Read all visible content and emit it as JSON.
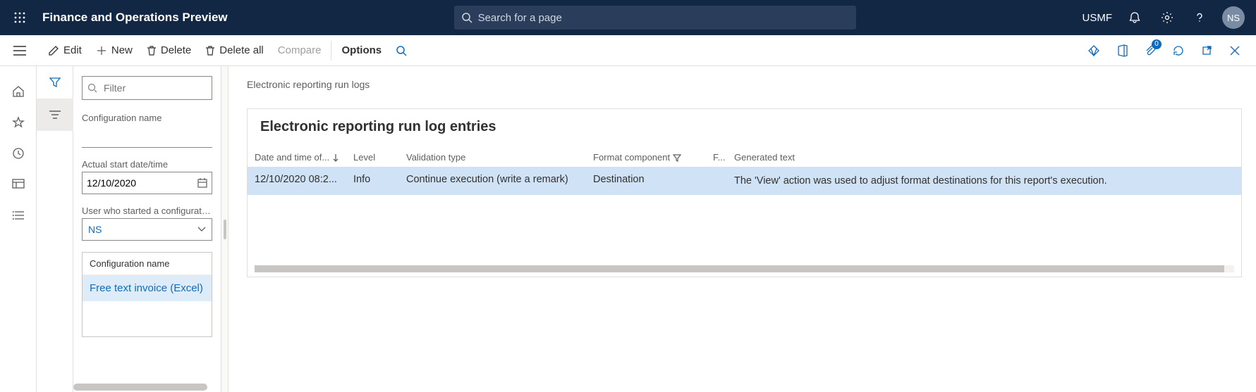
{
  "header": {
    "title": "Finance and Operations Preview",
    "search_placeholder": "Search for a page",
    "legal_entity": "USMF",
    "avatar_initials": "NS",
    "attach_badge": "0"
  },
  "actions": {
    "edit": "Edit",
    "new": "New",
    "delete": "Delete",
    "delete_all": "Delete all",
    "compare": "Compare",
    "options": "Options"
  },
  "sidepanel": {
    "filter_placeholder": "Filter",
    "config_label": "Configuration name",
    "config_value": "",
    "start_label": "Actual start date/time",
    "start_value": "12/10/2020",
    "user_label": "User who started a configuration",
    "user_value": "NS",
    "list_header": "Configuration name",
    "list_item": "Free text invoice (Excel)"
  },
  "main": {
    "breadcrumb": "Electronic reporting run logs",
    "panel_title": "Electronic reporting run log entries",
    "columns": {
      "c0": "Date and time of...",
      "c1": "Level",
      "c2": "Validation type",
      "c3": "Format component",
      "c4": "F...",
      "c5": "Generated text"
    },
    "row": {
      "c0": "12/10/2020 08:2...",
      "c1": "Info",
      "c2": "Continue execution (write a remark)",
      "c3": "Destination",
      "c4": "",
      "c5": "The 'View' action was used to adjust format destinations for this report's execution."
    }
  }
}
